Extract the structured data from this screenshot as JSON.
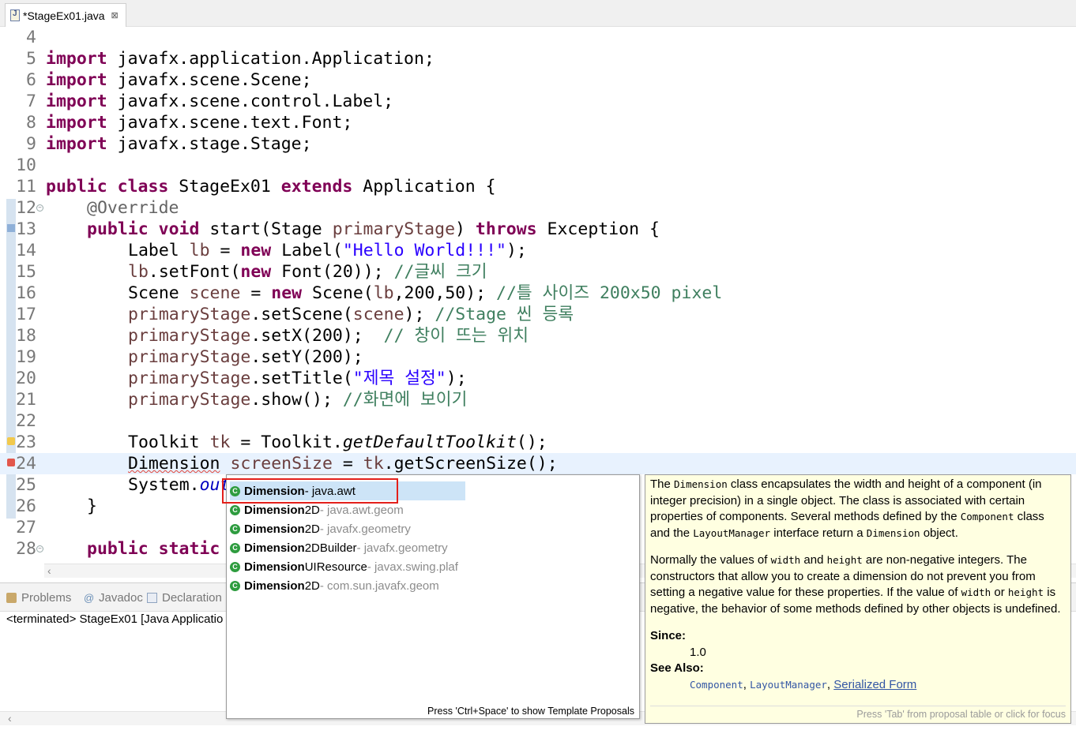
{
  "tab": {
    "title": "*StageEx01.java",
    "close": "⊠"
  },
  "editor": {
    "lines": [
      {
        "n": "4"
      },
      {
        "n": "5"
      },
      {
        "n": "6"
      },
      {
        "n": "7"
      },
      {
        "n": "8"
      },
      {
        "n": "9"
      },
      {
        "n": "10"
      },
      {
        "n": "11"
      },
      {
        "n": "12"
      },
      {
        "n": "13"
      },
      {
        "n": "14"
      },
      {
        "n": "15"
      },
      {
        "n": "16"
      },
      {
        "n": "17"
      },
      {
        "n": "18"
      },
      {
        "n": "19"
      },
      {
        "n": "20"
      },
      {
        "n": "21"
      },
      {
        "n": "22"
      },
      {
        "n": "23"
      },
      {
        "n": "24"
      },
      {
        "n": "25"
      },
      {
        "n": "26"
      },
      {
        "n": "27"
      },
      {
        "n": "28"
      }
    ],
    "code": {
      "l5": "javafx.application.Application;",
      "l6": "javafx.scene.Scene;",
      "l7": "javafx.scene.control.Label;",
      "l8": "javafx.scene.text.Font;",
      "l9": "javafx.stage.Stage;",
      "import_kw": "import",
      "l11_a": "public",
      "l11_b": "class",
      "l11_c": " StageEx01 ",
      "l11_d": "extends",
      "l11_e": " Application {",
      "l12": "@Override",
      "l13_a": "public",
      "l13_b": "void",
      "l13_c": " start(Stage ",
      "l13_d": "primaryStage",
      "l13_e": ") ",
      "l13_f": "throws",
      "l13_g": " Exception {",
      "l14_a": "Label ",
      "l14_b": "lb",
      "l14_c": " = ",
      "l14_d": "new",
      "l14_e": " Label(",
      "l14_f": "\"Hello World!!!\"",
      "l14_g": ");",
      "l15_a": "lb",
      "l15_b": ".setFont(",
      "l15_c": "new",
      "l15_d": " Font(20)); ",
      "l15_e": "//글씨 크기",
      "l16_a": "Scene ",
      "l16_b": "scene",
      "l16_c": " = ",
      "l16_d": "new",
      "l16_e": " Scene(",
      "l16_f": "lb",
      "l16_g": ",200,50); ",
      "l16_h": "//틀 사이즈 200x50 pixel",
      "l17_a": "primaryStage",
      "l17_b": ".setScene(",
      "l17_c": "scene",
      "l17_d": "); ",
      "l17_e": "//Stage 씬 등록",
      "l18_a": "primaryStage",
      "l18_b": ".setX(200);  ",
      "l18_c": "// 창이 뜨는 위치",
      "l19_a": "primaryStage",
      "l19_b": ".setY(200);",
      "l20_a": "primaryStage",
      "l20_b": ".setTitle(",
      "l20_c": "\"제목 설정\"",
      "l20_d": ");",
      "l21_a": "primaryStage",
      "l21_b": ".show(); ",
      "l21_c": "//화면에 보이기",
      "l23_a": "Toolkit ",
      "l23_b": "tk",
      "l23_c": " = Toolkit.",
      "l23_d": "getDefaultToolkit",
      "l23_e": "();",
      "l24_a": "Dimension",
      "l24_b": " ",
      "l24_c": "screenSize",
      "l24_d": " = ",
      "l24_e": "tk",
      "l24_f": ".getScreenSize();",
      "l25_a": "System.",
      "l25_b": "out",
      "l26": "}",
      "l28_a": "public",
      "l28_b": "static"
    }
  },
  "bottom": {
    "tabs": [
      "Problems",
      "Javadoc",
      "Declaration"
    ],
    "console": "<terminated> StageEx01 [Java Applicatio"
  },
  "proposals": {
    "items": [
      {
        "name": "Dimension",
        "rest": "",
        "pkg": " - java.awt"
      },
      {
        "name": "Dimension",
        "rest": "2D",
        "pkg": " - java.awt.geom"
      },
      {
        "name": "Dimension",
        "rest": "2D",
        "pkg": " - javafx.geometry"
      },
      {
        "name": "Dimension",
        "rest": "2DBuilder",
        "pkg": " - javafx.geometry"
      },
      {
        "name": "Dimension",
        "rest": "UIResource",
        "pkg": " - javax.swing.plaf"
      },
      {
        "name": "Dimension",
        "rest": "2D",
        "pkg": " - com.sun.javafx.geom"
      }
    ],
    "footer": "Press 'Ctrl+Space' to show Template Proposals"
  },
  "javadoc": {
    "p1_a": "The ",
    "p1_code1": "Dimension",
    "p1_b": " class encapsulates the width and height of a component (in integer precision) in a single object. The class is associated with certain properties of components. Several methods defined by the ",
    "p1_code2": "Component",
    "p1_c": " class and the ",
    "p1_code3": "LayoutManager",
    "p1_d": " interface return a ",
    "p1_code4": "Dimension",
    "p1_e": " object.",
    "p2_a": "Normally the values of ",
    "p2_code1": "width",
    "p2_b": " and ",
    "p2_code2": "height",
    "p2_c": " are non-negative integers. The constructors that allow you to create a dimension do not prevent you from setting a negative value for these properties. If the value of ",
    "p2_code3": "width",
    "p2_d": " or ",
    "p2_code4": "height",
    "p2_e": " is negative, the behavior of some methods defined by other objects is undefined.",
    "since_label": "Since:",
    "since_value": "1.0",
    "see_label": "See Also:",
    "see_1": "Component",
    "see_sep1": ", ",
    "see_2": "LayoutManager",
    "see_sep2": ", ",
    "see_3": "Serialized Form",
    "footer": "Press 'Tab' from proposal table or click for focus"
  }
}
